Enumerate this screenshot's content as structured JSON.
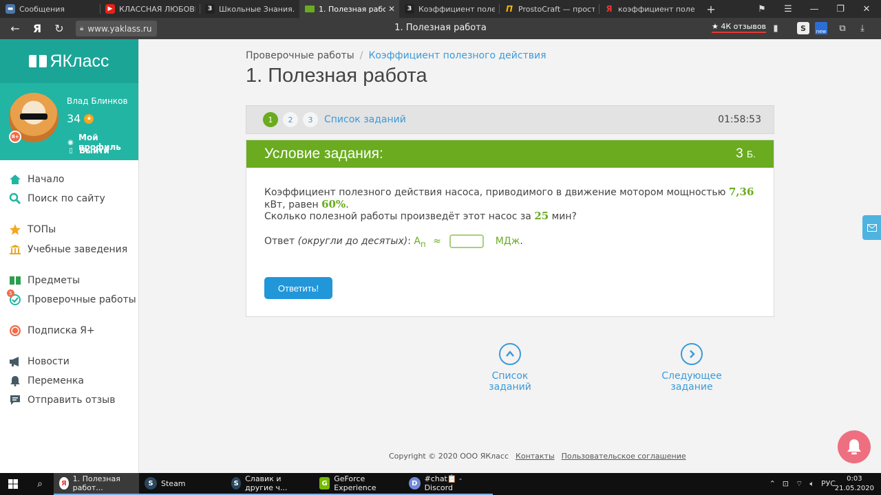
{
  "browser": {
    "tabs": [
      {
        "title": "Сообщения",
        "color": "#4a76a8",
        "glyph": ""
      },
      {
        "title": "КЛАССНАЯ ЛЮБОВЬ - ",
        "color": "#e62117",
        "glyph": "▶"
      },
      {
        "title": "Школьные Знания.com",
        "color": "#222222",
        "glyph": "З"
      },
      {
        "title": "1. Полезная работа",
        "color": "#6aab1f",
        "glyph": ""
      },
      {
        "title": "Коэффициент полезно",
        "color": "#222222",
        "glyph": "З"
      },
      {
        "title": "ProstoCraft — просто M",
        "color": "#f7b500",
        "glyph": "Π"
      },
      {
        "title": "коэффициент полезно",
        "color": "#e53935",
        "glyph": "Я"
      }
    ],
    "url": "www.yaklass.ru",
    "page_title": "1. Полезная работа",
    "reviews": "★ 4К отзывов",
    "new_badge": "new"
  },
  "sidebar": {
    "logo": "ЯКласс",
    "user_name": "Влад Блинков",
    "points": "34",
    "profile_link": "Мой профиль",
    "logout_link": "Выйти",
    "avatar_badge": "Я+",
    "menu": [
      {
        "label": "Начало",
        "icon": "home-icon"
      },
      {
        "label": "Поиск по сайту",
        "icon": "search-icon"
      },
      {
        "label": "ТОПы",
        "icon": "star-icon"
      },
      {
        "label": "Учебные заведения",
        "icon": "school-icon"
      },
      {
        "label": "Предметы",
        "icon": "book-icon"
      },
      {
        "label": "Проверочные работы",
        "icon": "check-icon",
        "badge": "5"
      },
      {
        "label": "Подписка Я+",
        "icon": "subscription-icon"
      },
      {
        "label": "Новости",
        "icon": "megaphone-icon"
      },
      {
        "label": "Переменка",
        "icon": "bell-icon"
      },
      {
        "label": "Отправить отзыв",
        "icon": "feedback-icon"
      }
    ]
  },
  "main": {
    "breadcrumb_root": "Проверочные работы",
    "breadcrumb_sep": "/",
    "breadcrumb_current": "Коэффициент полезного действия",
    "title": "1. Полезная работа",
    "pages": [
      "1",
      "2",
      "3"
    ],
    "task_list": "Список заданий",
    "timer": "01:58:53",
    "condition_title": "Условие задания:",
    "points_value": "3",
    "points_unit": "Б.",
    "line1_pre": "Коэффициент полезного действия насоса, приводимого в движение мотором мощностью ",
    "line1_power": "7,36",
    "line1_mid": " кВт, равен ",
    "line1_eff": "60%",
    "line1_end": ".",
    "line2_pre": "Сколько полезной работы произведёт этот насос за ",
    "line2_time": "25",
    "line2_end": " мин?",
    "answer_label": "Ответ ",
    "answer_hint": "(округли до десятых)",
    "answer_colon": ": ",
    "answer_var": "A",
    "answer_sub": "п",
    "answer_approx": "≈",
    "answer_value": "",
    "answer_unit": "МДж",
    "answer_dot": ".",
    "submit_label": "Ответить!",
    "nav_list": "Список заданий",
    "nav_next": "Следующее задание"
  },
  "footer": {
    "copyright": "Copyright © 2020 ООО ЯКласс",
    "contacts": "Контакты",
    "agreement": "Пользовательское соглашение"
  },
  "taskbar": {
    "items": [
      {
        "label": "1. Полезная работ...",
        "color": "#e53935",
        "glyph": "Я"
      },
      {
        "label": "Steam",
        "color": "#1b2838",
        "glyph": "S"
      },
      {
        "label": "Славик и другие ч...",
        "color": "#1b2838",
        "glyph": "S"
      },
      {
        "label": "GeForce Experience",
        "color": "#76b900",
        "glyph": "G"
      },
      {
        "label": "#chat📋 - Discord",
        "color": "#7289da",
        "glyph": "D"
      }
    ],
    "lang": "РУС",
    "time": "0:03",
    "date": "21.05.2020"
  }
}
